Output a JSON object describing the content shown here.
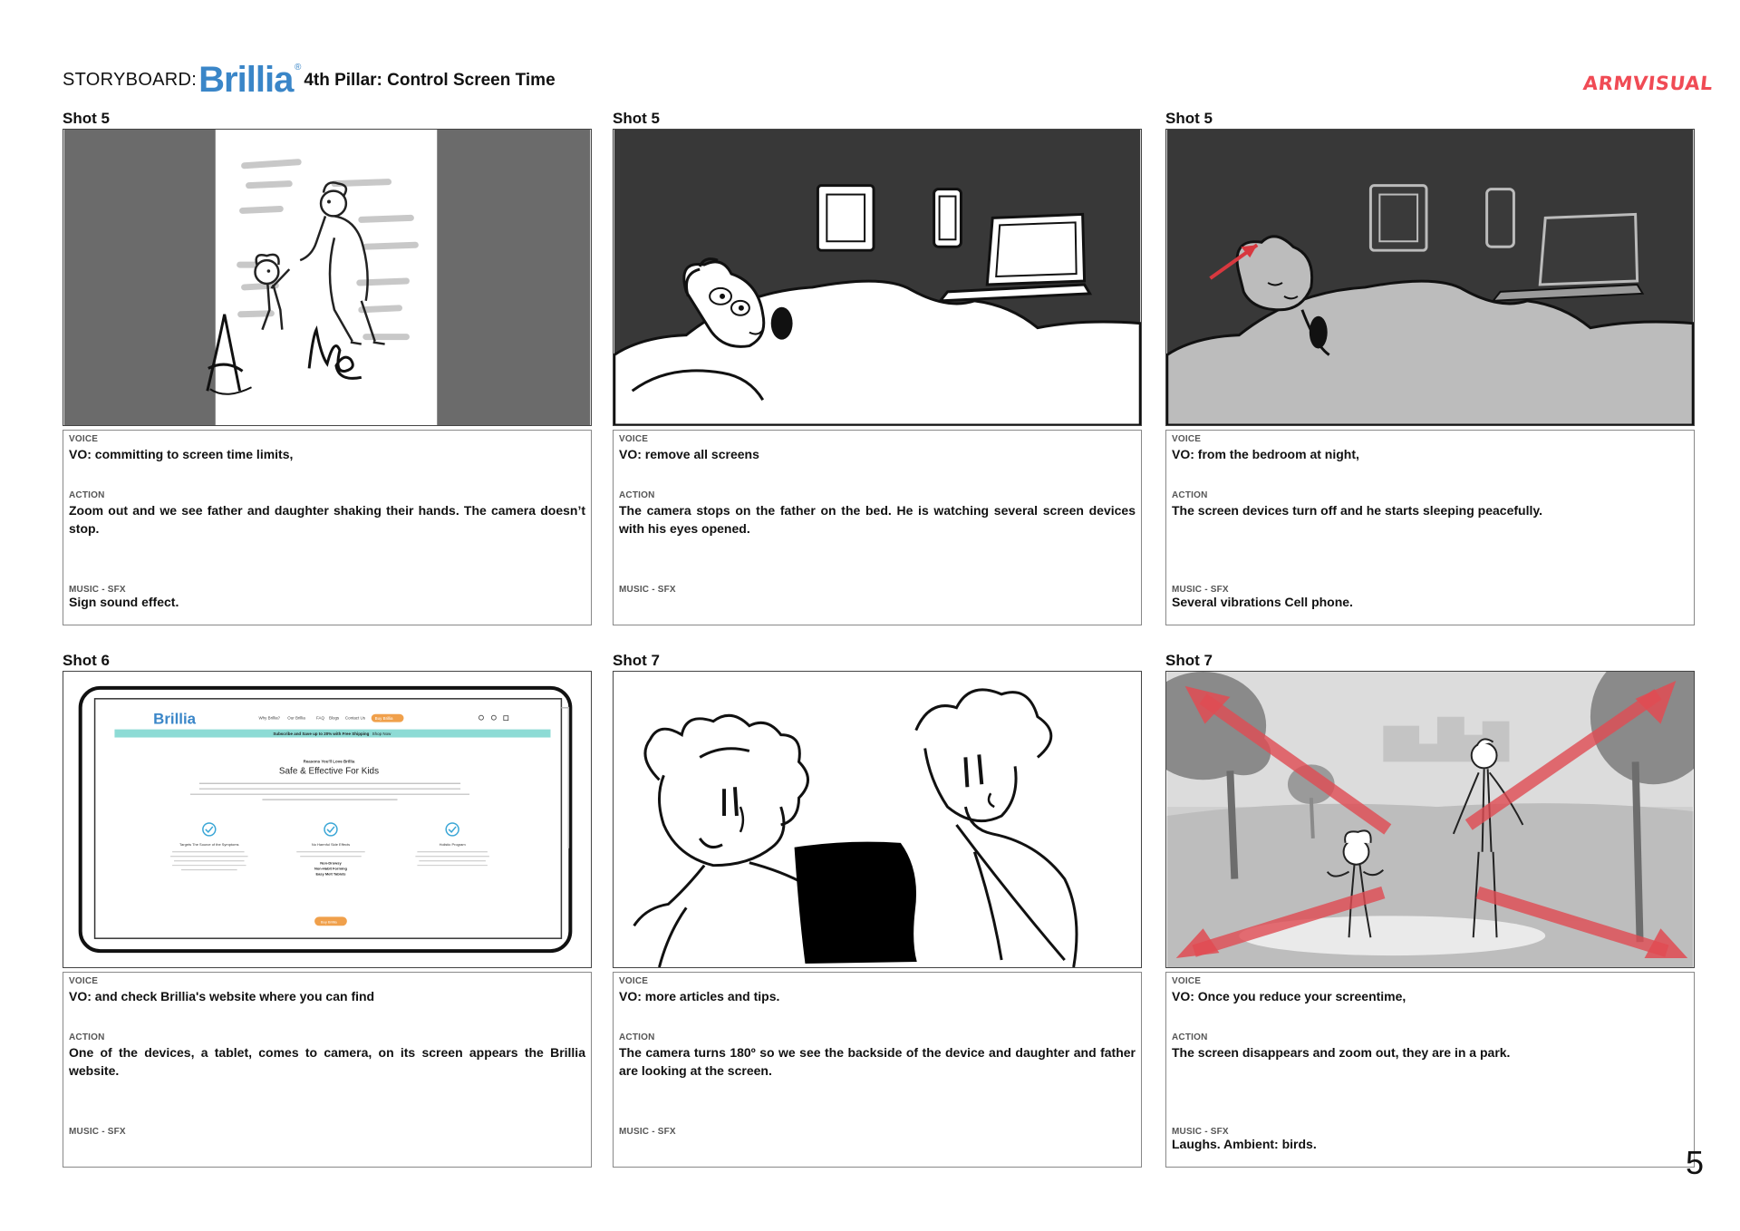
{
  "header": {
    "label": "STORYBOARD:",
    "brand": "Brillia",
    "brand_mark": "®",
    "subtitle": "4th Pillar: Control Screen Time",
    "studio": "ARMVISUAL",
    "brand_color": "#3a86c8",
    "studio_color": "#f04b55"
  },
  "shots": [
    {
      "label": "Shot 5",
      "voice_label": "VOICE",
      "voice": "VO: committing to screen time limits,",
      "action_label": "ACTION",
      "action": "Zoom out and we see father and daughter shaking their hands. The camera doesn’t stop.",
      "music_label": "MUSIC - SFX",
      "music": "Sign sound effect."
    },
    {
      "label": "Shot 5",
      "voice_label": "VOICE",
      "voice": "VO: remove all screens",
      "action_label": "ACTION",
      "action": "The camera stops on the father on the bed. He is watching several screen devices with his eyes opened.",
      "music_label": "MUSIC - SFX",
      "music": ""
    },
    {
      "label": "Shot 5",
      "voice_label": "VOICE",
      "voice": "VO: from the bedroom at night,",
      "action_label": "ACTION",
      "action": "The screen devices turn off and he starts sleeping peacefully.",
      "music_label": "MUSIC - SFX",
      "music": "Several vibrations Cell phone."
    },
    {
      "label": "Shot 6",
      "voice_label": "VOICE",
      "voice": "VO: and check Brillia's website where you can find",
      "action_label": "ACTION",
      "action": "One of the devices, a tablet, comes to camera, on its screen appears  the Brillia website.",
      "music_label": "MUSIC - SFX",
      "music": ""
    },
    {
      "label": "Shot 7",
      "voice_label": "VOICE",
      "voice": "VO: more articles and tips.",
      "action_label": "ACTION",
      "action": "The camera turns 180º so we see the backside of the device and daughter and father are looking at the screen.",
      "music_label": "MUSIC - SFX",
      "music": ""
    },
    {
      "label": "Shot 7",
      "voice_label": "VOICE",
      "voice": "VO: Once you reduce your screentime,",
      "action_label": "ACTION",
      "action": "The screen disappears and zoom out, they are in a park.",
      "music_label": "MUSIC - SFX",
      "music": "Laughs. Ambient: birds."
    }
  ],
  "tablet_site": {
    "logo": "Brillia",
    "nav": [
      "Why Brillia?",
      "Our Brillia",
      "FAQ",
      "Blogs",
      "Contact Us"
    ],
    "cta": "Buy Brillia",
    "banner": "Subscribe and Save up to 20% with Free Shipping",
    "banner_link": "Shop Now",
    "eyebrow": "Reasons You'll Love Brillia",
    "heading": "Safe & Effective For Kids",
    "features": [
      {
        "title": "Targets The Source of the Symptoms",
        "extra": []
      },
      {
        "title": "No Harmful Side Effects",
        "extra": [
          "Non-Drowsy",
          "Non-Habit Forming",
          "Easy Melt Tablets"
        ]
      },
      {
        "title": "Holistic Program",
        "extra": []
      }
    ],
    "button": "Buy Brillia"
  },
  "page_number": "5"
}
